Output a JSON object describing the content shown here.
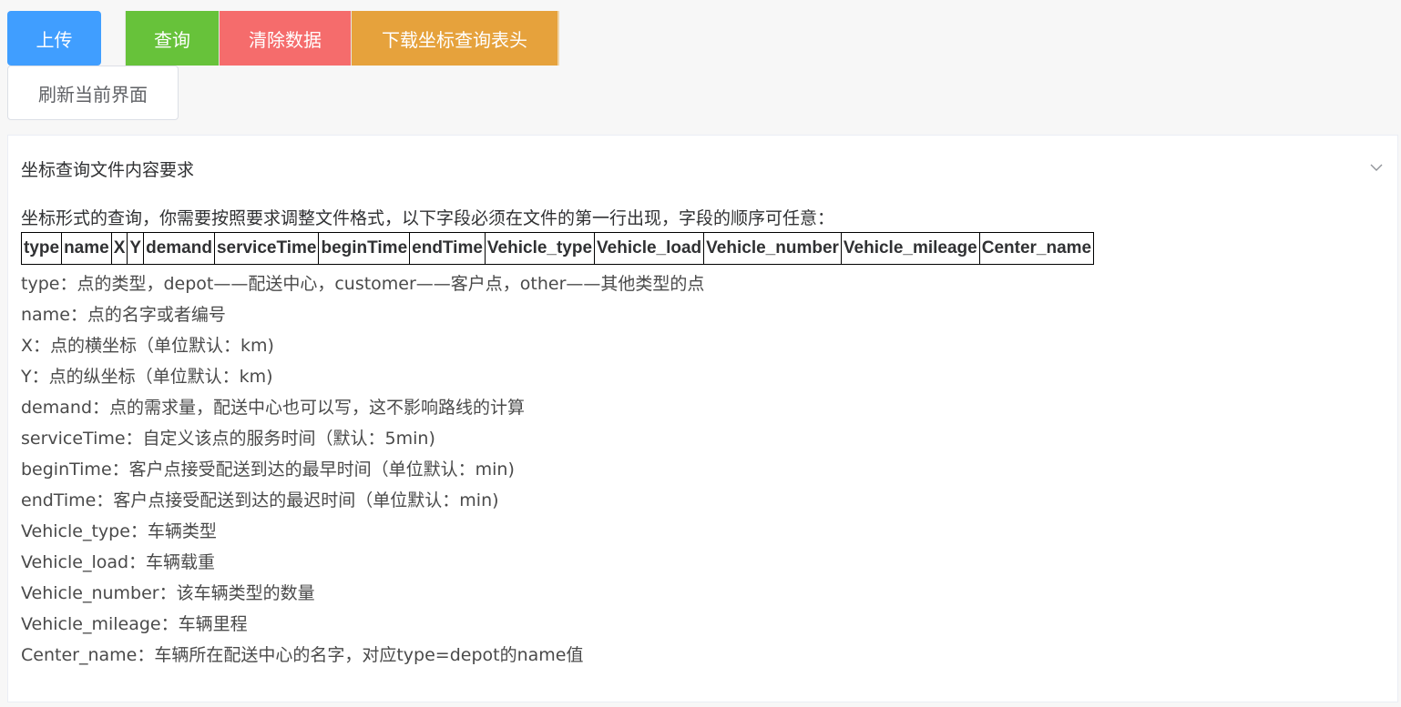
{
  "toolbar": {
    "upload_label": "上传",
    "query_label": "查询",
    "clear_label": "清除数据",
    "download_label": "下载坐标查询表头",
    "refresh_label": "刷新当前界面"
  },
  "panel": {
    "title": "坐标查询文件内容要求",
    "intro": "坐标形式的查询，你需要按照要求调整文件格式，以下字段必须在文件的第一行出现，字段的顺序可任意：",
    "fields": [
      "type",
      "name",
      "X",
      "Y",
      "demand",
      "serviceTime",
      "beginTime",
      "endTime",
      "Vehicle_type",
      "Vehicle_load",
      "Vehicle_number",
      "Vehicle_mileage",
      "Center_name"
    ],
    "descriptions": [
      "type：点的类型，depot——配送中心，customer——客户点，other——其他类型的点",
      "name：点的名字或者编号",
      "X：点的横坐标（单位默认：km)",
      "Y：点的纵坐标（单位默认：km)",
      "demand：点的需求量，配送中心也可以写，这不影响路线的计算",
      "serviceTime：自定义该点的服务时间（默认：5min)",
      "beginTime：客户点接受配送到达的最早时间（单位默认：min)",
      "endTime：客户点接受配送到达的最迟时间（单位默认：min)",
      "Vehicle_type：车辆类型",
      "Vehicle_load：车辆载重",
      "Vehicle_number：该车辆类型的数量",
      "Vehicle_mileage：车辆里程",
      "Center_name：车辆所在配送中心的名字，对应type=depot的name值"
    ]
  },
  "colors": {
    "upload": "#409eff",
    "query": "#67c23a",
    "clear": "#f56c6c",
    "download": "#e6a23c"
  },
  "icons": {
    "collapse": "chevron-down-icon"
  }
}
